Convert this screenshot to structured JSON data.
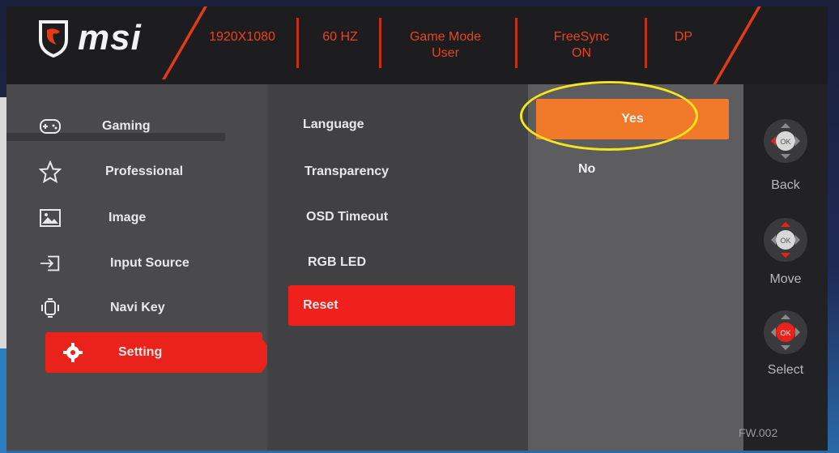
{
  "brand": "msi",
  "header": {
    "resolution": "1920X1080",
    "refresh": "60 HZ",
    "game_mode_line1": "Game Mode",
    "game_mode_line2": "User",
    "freesync_line1": "FreeSync",
    "freesync_line2": "ON",
    "input": "DP"
  },
  "main_menu": [
    {
      "label": "Gaming",
      "icon": "gamepad-icon"
    },
    {
      "label": "Professional",
      "icon": "star-icon"
    },
    {
      "label": "Image",
      "icon": "image-icon"
    },
    {
      "label": "Input Source",
      "icon": "input-source-icon"
    },
    {
      "label": "Navi Key",
      "icon": "navi-key-icon"
    },
    {
      "label": "Setting",
      "icon": "gear-icon",
      "active": true
    }
  ],
  "sub_menu": [
    {
      "label": "Language"
    },
    {
      "label": "Transparency"
    },
    {
      "label": "OSD Timeout"
    },
    {
      "label": "RGB LED"
    },
    {
      "label": "Reset",
      "active": true
    }
  ],
  "options": {
    "yes": "Yes",
    "no": "No",
    "selected": "Yes"
  },
  "nav_keys": {
    "back": "Back",
    "move": "Move",
    "select": "Select",
    "ok": "OK"
  },
  "firmware": "FW.002",
  "colors": {
    "accent_red": "#e9221b",
    "option_orange": "#f07a2a",
    "highlight_circle": "#f5e51e"
  }
}
